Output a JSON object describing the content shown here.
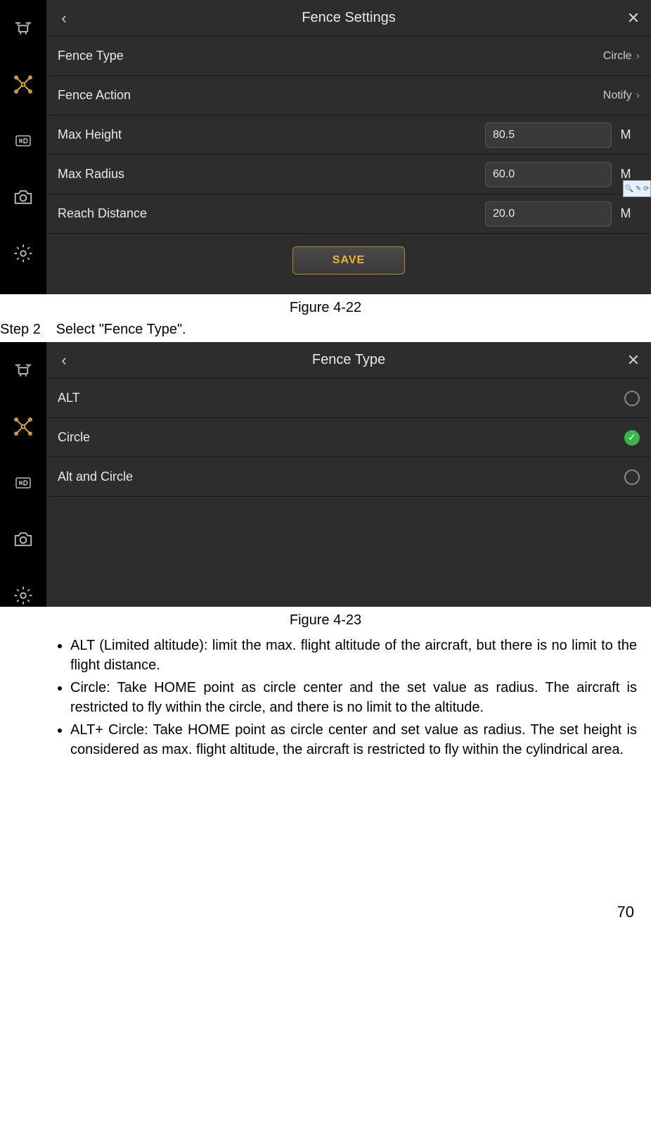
{
  "figure1": {
    "title": "Fence Settings",
    "rows": {
      "fenceType": {
        "label": "Fence Type",
        "value": "Circle"
      },
      "fenceAction": {
        "label": "Fence Action",
        "value": "Notify"
      },
      "maxHeight": {
        "label": "Max Height",
        "value": "80.5",
        "unit": "M"
      },
      "maxRadius": {
        "label": "Max Radius",
        "value": "60.0",
        "unit": "M"
      },
      "reachDistance": {
        "label": "Reach Distance",
        "value": "20.0",
        "unit": "M"
      }
    },
    "saveLabel": "SAVE",
    "caption": "Figure 4-22"
  },
  "step2": {
    "step": "Step 2",
    "text": "Select \"Fence Type\"."
  },
  "figure2": {
    "title": "Fence Type",
    "options": {
      "alt": "ALT",
      "circle": "Circle",
      "altAndCircle": "Alt and Circle"
    },
    "caption": "Figure 4-23"
  },
  "bullets": {
    "b1": "ALT (Limited altitude): limit the max. flight altitude of the aircraft, but there is no limit to the flight distance.",
    "b2": "Circle: Take HOME point as circle center and the set value as radius. The aircraft is restricted to fly within the circle, and there is no limit to the altitude.",
    "b3": "ALT+ Circle: Take HOME point as circle center and set value as radius. The set height is considered as max. flight altitude, the aircraft is restricted to fly within the cylindrical area."
  },
  "pageNumber": "70"
}
